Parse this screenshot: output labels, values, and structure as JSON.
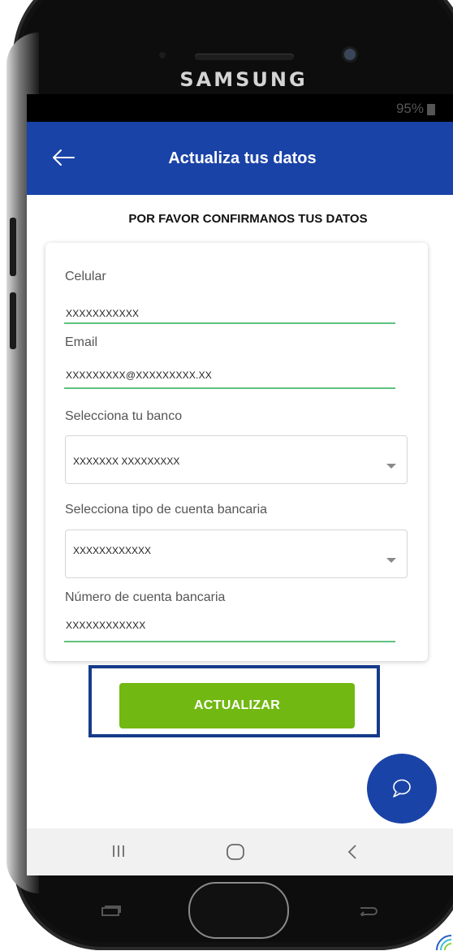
{
  "device": {
    "brand": "SAMSUNG"
  },
  "status_bar": {
    "battery": "95%",
    "battery_icon": "battery-icon"
  },
  "app_bar": {
    "back_icon": "arrow-left-icon",
    "title": "Actualiza tus datos"
  },
  "form": {
    "subtitle": "POR FAVOR CONFIRMANOS TUS DATOS",
    "celular": {
      "label": "Celular",
      "value": "XXXXXXXXXXX"
    },
    "email": {
      "label": "Email",
      "value": "XXXXXXXXX@XXXXXXXXX.XX"
    },
    "banco": {
      "label": "Selecciona tu banco",
      "value": "XXXXXXX XXXXXXXXX"
    },
    "tipo_cuenta": {
      "label": "Selecciona tipo de cuenta bancaria",
      "value": "XXXXXXXXXXXX"
    },
    "numero_cuenta": {
      "label": "Número de cuenta bancaria",
      "value": "XXXXXXXXXXXX"
    },
    "submit_label": "ACTUALIZAR"
  },
  "chat_button": {
    "icon": "chat-bubble-icon"
  },
  "nav_bar": {
    "recents_icon": "recent-apps-icon",
    "home_icon": "home-icon",
    "back_icon": "back-chevron-icon"
  },
  "colors": {
    "primary_blue": "#1a43a7",
    "button_green": "#71b812",
    "input_underline": "#5fc27e",
    "highlight_border": "#163b8a"
  }
}
